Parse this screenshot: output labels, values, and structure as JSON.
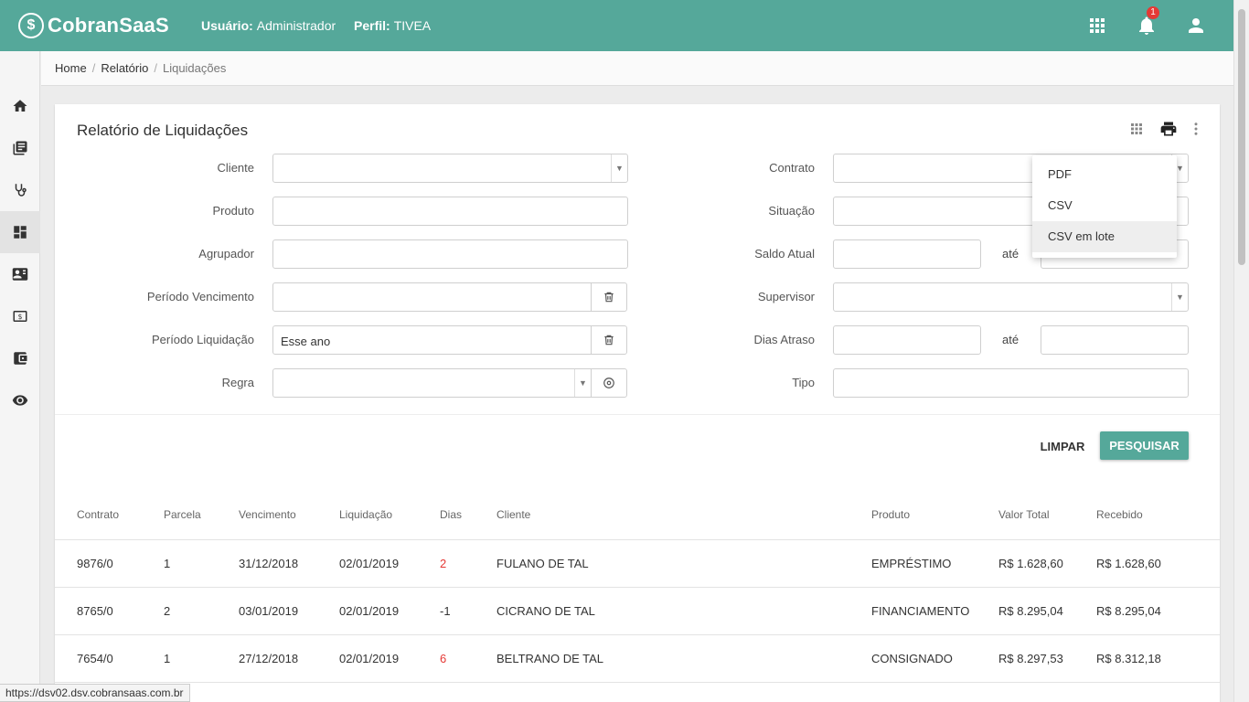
{
  "app": {
    "logo_text": "CobranSaaS"
  },
  "topbar": {
    "user_label": "Usuário:",
    "user_value": "Administrador",
    "profile_label": "Perfil:",
    "profile_value": "TIVEA",
    "notifications_count": "1"
  },
  "breadcrumb": {
    "home": "Home",
    "relatorio": "Relatório",
    "current": "Liquidações"
  },
  "page": {
    "title": "Relatório de Liquidações"
  },
  "filters": {
    "cliente": "Cliente",
    "produto": "Produto",
    "agrupador": "Agrupador",
    "periodo_vencimento": "Período Vencimento",
    "periodo_liquidacao": "Período Liquidação",
    "periodo_liquidacao_value": "Esse ano",
    "regra": "Regra",
    "contrato": "Contrato",
    "situacao": "Situação",
    "saldo_atual": "Saldo Atual",
    "supervisor": "Supervisor",
    "dias_atraso": "Dias Atraso",
    "tipo": "Tipo",
    "ate": "até"
  },
  "buttons": {
    "limpar": "LIMPAR",
    "pesquisar": "PESQUISAR"
  },
  "export_menu": {
    "items": [
      "PDF",
      "CSV",
      "CSV em lote"
    ]
  },
  "table": {
    "headers": [
      "Contrato",
      "Parcela",
      "Vencimento",
      "Liquidação",
      "Dias",
      "Cliente",
      "Produto",
      "Valor Total",
      "Recebido"
    ],
    "rows": [
      [
        "9876/0",
        "1",
        "31/12/2018",
        "02/01/2019",
        "2",
        "FULANO DE TAL",
        "EMPRÉSTIMO",
        "R$ 1.628,60",
        "R$ 1.628,60"
      ],
      [
        "8765/0",
        "2",
        "03/01/2019",
        "02/01/2019",
        "-1",
        "CICRANO DE TAL",
        "FINANCIAMENTO",
        "R$ 8.295,04",
        "R$ 8.295,04"
      ],
      [
        "7654/0",
        "1",
        "27/12/2018",
        "02/01/2019",
        "6",
        "BELTRANO DE TAL",
        "CONSIGNADO",
        "R$ 8.297,53",
        "R$ 8.312,18"
      ]
    ]
  },
  "statusbar": {
    "url": "https://dsv02.dsv.cobransaas.com.br"
  },
  "colors": {
    "primary": "#55a89a",
    "badge": "#e53935",
    "late_days": "#e53935"
  },
  "icons": {
    "topbar": [
      "apps-grid-icon",
      "bell-icon",
      "account-icon"
    ],
    "sidenav": [
      "home-icon",
      "book-icon",
      "stethoscope-icon",
      "dashboard-icon",
      "contact-card-icon",
      "money-icon",
      "wallet-icon",
      "eye-icon"
    ],
    "card_tools": [
      "grid-icon",
      "print-icon",
      "more-vert-icon"
    ]
  }
}
